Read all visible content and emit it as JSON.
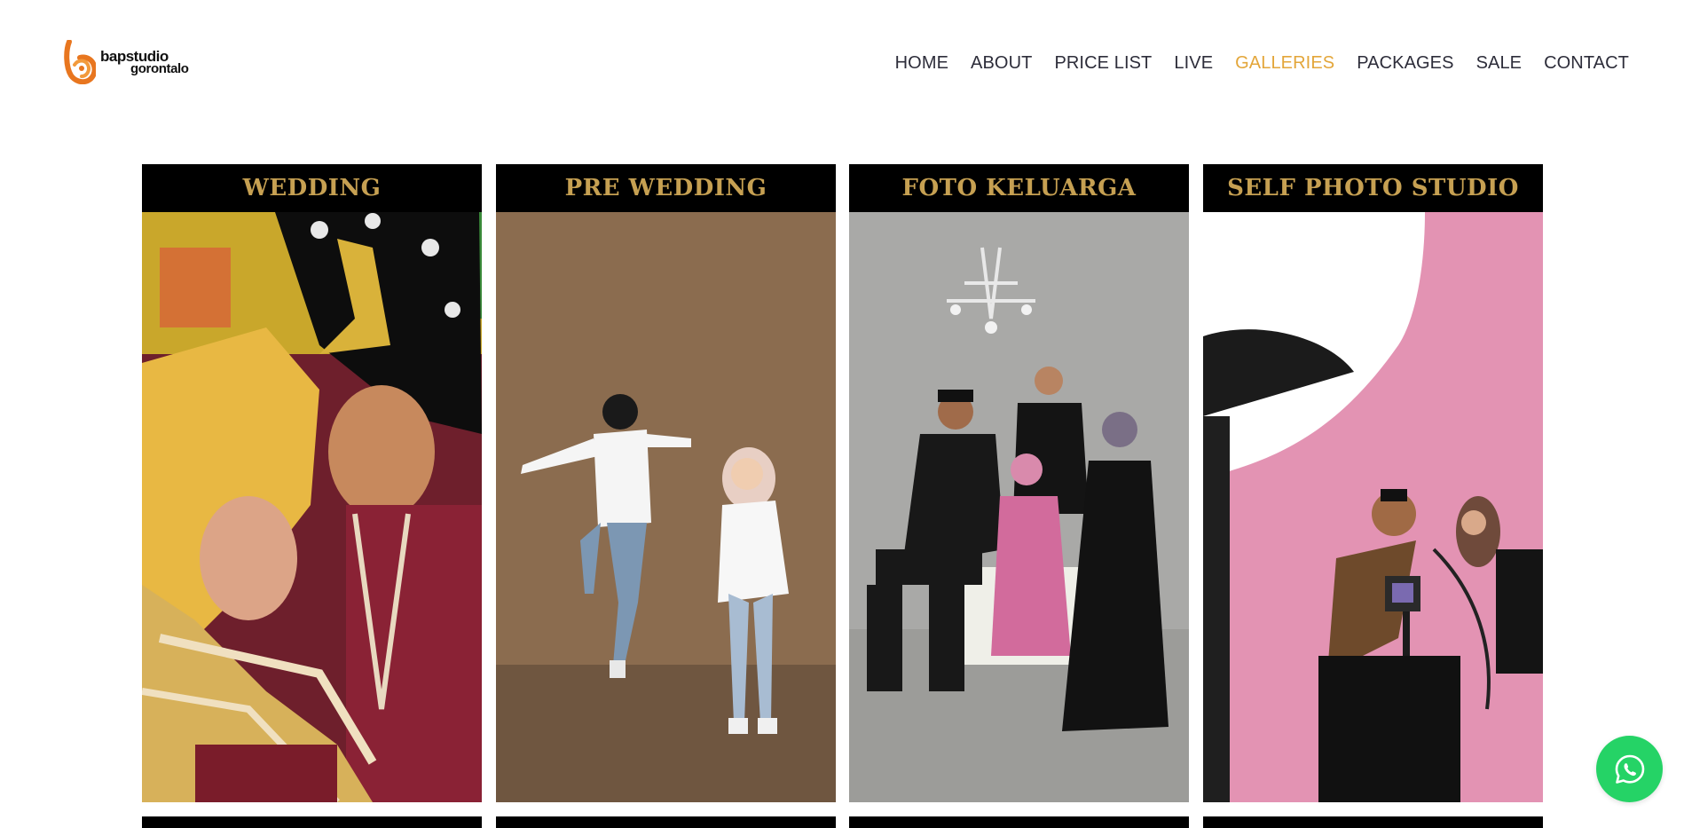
{
  "brand": {
    "line1": "bapstudio",
    "line2": "gorontalo",
    "accent": "#e8761f"
  },
  "nav": [
    {
      "label": "HOME",
      "active": false
    },
    {
      "label": "ABOUT",
      "active": false
    },
    {
      "label": "PRICE LIST",
      "active": false
    },
    {
      "label": "LIVE",
      "active": false
    },
    {
      "label": "GALLERIES",
      "active": true
    },
    {
      "label": "PACKAGES",
      "active": false
    },
    {
      "label": "SALE",
      "active": false
    },
    {
      "label": "CONTACT",
      "active": false
    }
  ],
  "colors": {
    "active_nav": "#e3a63a",
    "nav_text": "#2d2d3a",
    "card_title": "#c6a052",
    "whatsapp": "#25d366"
  },
  "galleries": [
    {
      "title": "WEDDING"
    },
    {
      "title": "PRE WEDDING"
    },
    {
      "title": "FOTO KELUARGA"
    },
    {
      "title": "SELF PHOTO STUDIO"
    }
  ],
  "floating": {
    "icon": "whatsapp-icon"
  }
}
